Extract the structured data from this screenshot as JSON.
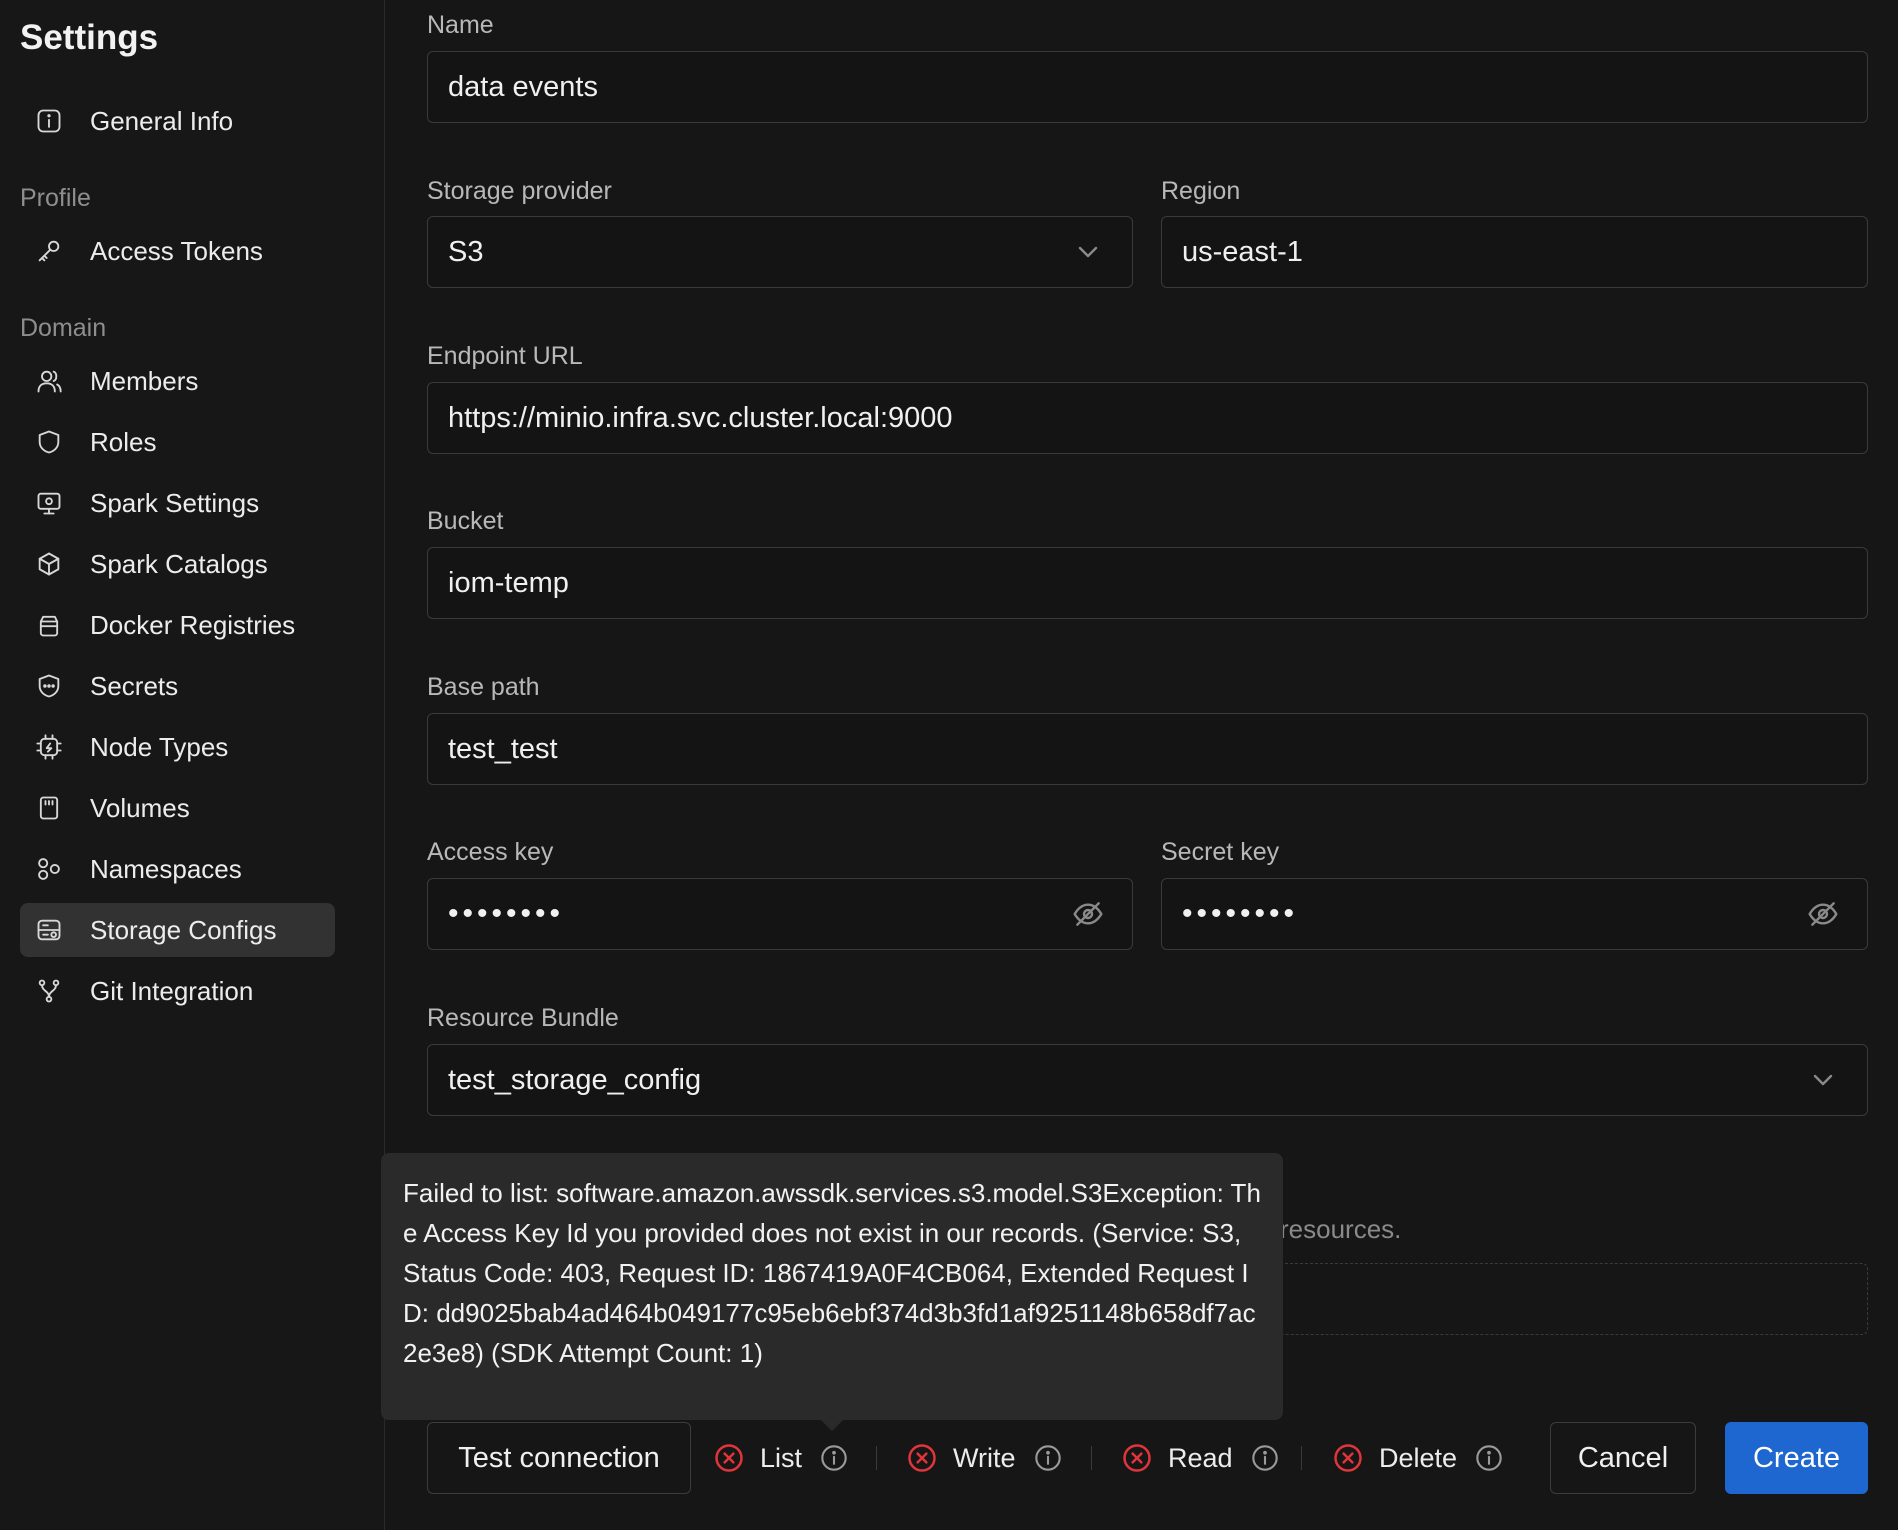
{
  "sidebar": {
    "title": "Settings",
    "top_items": [
      {
        "label": "General Info",
        "icon": "info-icon"
      }
    ],
    "profile_label": "Profile",
    "profile_items": [
      {
        "label": "Access Tokens",
        "icon": "key-icon"
      }
    ],
    "domain_label": "Domain",
    "domain_items": [
      {
        "label": "Members",
        "icon": "users-icon"
      },
      {
        "label": "Roles",
        "icon": "shield-icon"
      },
      {
        "label": "Spark Settings",
        "icon": "monitor-settings-icon"
      },
      {
        "label": "Spark Catalogs",
        "icon": "cube-icon"
      },
      {
        "label": "Docker Registries",
        "icon": "container-icon"
      },
      {
        "label": "Secrets",
        "icon": "shield-dots-icon"
      },
      {
        "label": "Node Types",
        "icon": "cpu-icon"
      },
      {
        "label": "Volumes",
        "icon": "storage-card-icon"
      },
      {
        "label": "Namespaces",
        "icon": "namespaces-icon"
      },
      {
        "label": "Storage Configs",
        "icon": "storage-configs-icon",
        "active": true
      },
      {
        "label": "Git Integration",
        "icon": "git-branch-icon"
      }
    ]
  },
  "form": {
    "name_label": "Name",
    "name_value": "data events",
    "provider_label": "Storage provider",
    "provider_value": "S3",
    "region_label": "Region",
    "region_value": "us-east-1",
    "endpoint_label": "Endpoint URL",
    "endpoint_value": "https://minio.infra.svc.cluster.local:9000",
    "bucket_label": "Bucket",
    "bucket_value": "iom-temp",
    "base_path_label": "Base path",
    "base_path_value": "test_test",
    "access_key_label": "Access key",
    "access_key_value": "••••••••",
    "secret_key_label": "Secret key",
    "secret_key_value": "••••••••",
    "bundle_label": "Resource Bundle",
    "bundle_value": "test_storage_config",
    "hint_partial": "resources."
  },
  "tooltip": {
    "text": "Failed to list: software.amazon.awssdk.services.s3.model.S3Exception: The Access Key Id you provided does not exist in our records. (Service: S3, Status Code: 403, Request ID: 1867419A0F4CB064, Extended Request ID: dd9025bab4ad464b049177c95eb6ebf374d3b3fd1af9251148b658df7ac2e3e8) (SDK Attempt Count: 1)"
  },
  "actions": {
    "test_connection": "Test connection",
    "checks": [
      {
        "label": "List",
        "status": "failed"
      },
      {
        "label": "Write",
        "status": "failed"
      },
      {
        "label": "Read",
        "status": "failed"
      },
      {
        "label": "Delete",
        "status": "failed"
      }
    ],
    "cancel": "Cancel",
    "create": "Create"
  },
  "colors": {
    "accent": "#1e66d0",
    "error": "#e0353a",
    "background": "#161616"
  }
}
